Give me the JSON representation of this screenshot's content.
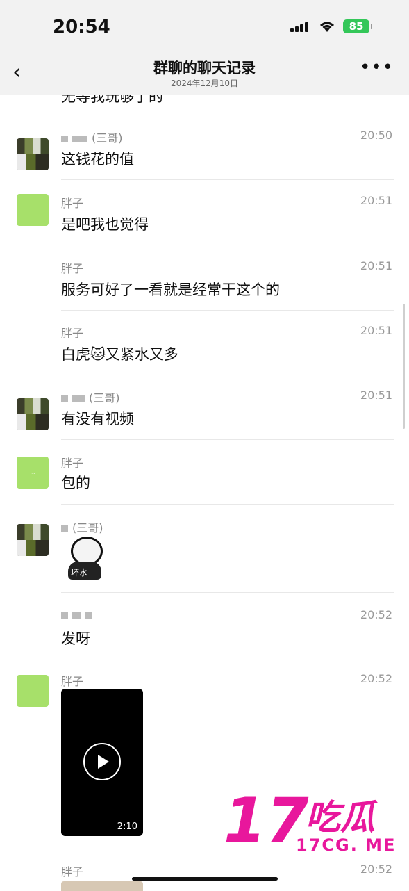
{
  "status": {
    "time": "20:54",
    "battery": "85"
  },
  "nav": {
    "back_icon": "‹",
    "title": "群聊的聊天记录",
    "date": "2024年12月10日",
    "more_icon": "•••"
  },
  "top_cut_text": "无等我玩够了的",
  "messages": [
    {
      "sender": "(三哥)",
      "time": "20:50",
      "text": "这钱花的值"
    },
    {
      "sender": "胖子",
      "time": "20:51",
      "text": "是吧我也觉得"
    },
    {
      "sender": "胖子",
      "time": "20:51",
      "text": "服务可好了一看就是经常干这个的"
    },
    {
      "sender": "胖子",
      "time": "20:51",
      "text": "白虎🐱又紧水又多"
    },
    {
      "sender": "(三哥)",
      "time": "20:51",
      "text": "有没有视频"
    },
    {
      "sender": "胖子",
      "time": "",
      "text": "包的"
    },
    {
      "sender": "(三哥)",
      "time": "",
      "sticker_label": "坏水"
    },
    {
      "sender": "",
      "time": "20:52",
      "text": "发呀"
    },
    {
      "sender": "胖子",
      "time": "20:52",
      "video_duration": "2:10"
    },
    {
      "sender": "胖子",
      "time": "20:52"
    }
  ],
  "watermark": {
    "num": "17",
    "cn": "吃瓜",
    "url": "17CG. ME"
  }
}
